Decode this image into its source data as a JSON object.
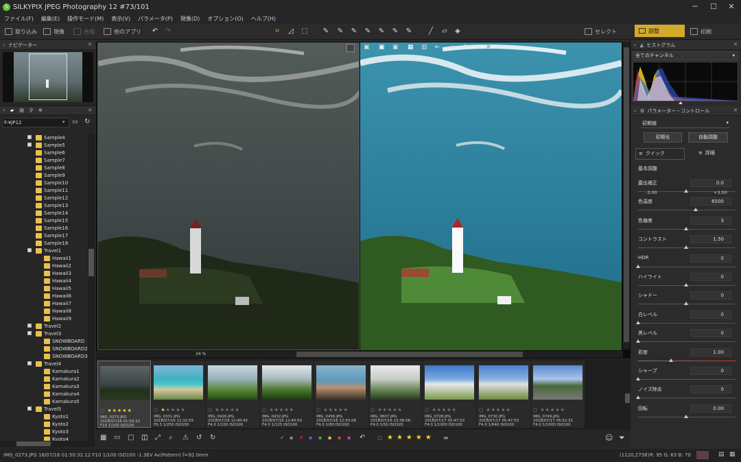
{
  "app": {
    "title": "SILKYPIX JPEG Photography 12   #73/101"
  },
  "menu": [
    "ファイル(F)",
    "編集(E)",
    "操作モード(M)",
    "表示(V)",
    "パラメータ(P)",
    "現像(D)",
    "オプション(O)",
    "ヘルプ(H)"
  ],
  "toolbar": {
    "import": "取り込み",
    "develop": "現像",
    "compose": "合成",
    "other_apps": "他のアプリ",
    "select": "セレクト",
    "adjust": "調整",
    "print": "印刷"
  },
  "navigator": {
    "title": "ナビゲーター"
  },
  "folder": {
    "path": "F:¥JP12"
  },
  "tree": [
    {
      "label": "Sample4",
      "level": 1,
      "exp": "+"
    },
    {
      "label": "Sample5",
      "level": 1,
      "exp": "+"
    },
    {
      "label": "Sample6",
      "level": 1
    },
    {
      "label": "Sample7",
      "level": 1
    },
    {
      "label": "Sample8",
      "level": 1
    },
    {
      "label": "Sample9",
      "level": 1
    },
    {
      "label": "Sample10",
      "level": 1
    },
    {
      "label": "Sample11",
      "level": 1
    },
    {
      "label": "Sample12",
      "level": 1
    },
    {
      "label": "Sample13",
      "level": 1
    },
    {
      "label": "Sample14",
      "level": 1
    },
    {
      "label": "Sample15",
      "level": 1
    },
    {
      "label": "Sample16",
      "level": 1
    },
    {
      "label": "Sample17",
      "level": 1
    },
    {
      "label": "Sample18",
      "level": 1
    },
    {
      "label": "Travel1",
      "level": 1,
      "exp": "-"
    },
    {
      "label": "Hawaii1",
      "level": 2
    },
    {
      "label": "Hawaii2",
      "level": 2
    },
    {
      "label": "Hawaii3",
      "level": 2
    },
    {
      "label": "Hawaii4",
      "level": 2
    },
    {
      "label": "Hawaii5",
      "level": 2
    },
    {
      "label": "Hawaii6",
      "level": 2
    },
    {
      "label": "Hawaii7",
      "level": 2
    },
    {
      "label": "Hawaii8",
      "level": 2
    },
    {
      "label": "Hawaii9",
      "level": 2
    },
    {
      "label": "Travel2",
      "level": 1,
      "exp": "+"
    },
    {
      "label": "Travel3",
      "level": 1,
      "exp": "-"
    },
    {
      "label": "SNOWBOARD",
      "level": 2
    },
    {
      "label": "SNOWBOARD2",
      "level": 2
    },
    {
      "label": "SNOWBOARD3",
      "level": 2
    },
    {
      "label": "Travel4",
      "level": 1,
      "exp": "-"
    },
    {
      "label": "Kamakura1",
      "level": 2
    },
    {
      "label": "Kamakura2",
      "level": 2
    },
    {
      "label": "Kamakura3",
      "level": 2
    },
    {
      "label": "Kamakura4",
      "level": 2
    },
    {
      "label": "Kamakura5",
      "level": 2
    },
    {
      "label": "Travel5",
      "level": 1,
      "exp": "-"
    },
    {
      "label": "Kyoto1",
      "level": 2
    },
    {
      "label": "Kyoto2",
      "level": 2
    },
    {
      "label": "Kyoto3",
      "level": 2
    },
    {
      "label": "Kyoto4",
      "level": 2
    }
  ],
  "viewer": {
    "zoom": "34"
  },
  "filmstrip": [
    {
      "name": "IMG_0273.JPG",
      "date": "2018/07/16 01:50:32",
      "exif": "F10 1/100 ISO100",
      "stars": 5,
      "scene": "light",
      "selected": true
    },
    {
      "name": "IMG_0331.JPG",
      "date": "2018/07/16 11:32:55",
      "exif": "F6.3 1/250 ISO100",
      "stars": 1,
      "scene": "beach"
    },
    {
      "name": "IMG_0426.JPG",
      "date": "2018/07/16 12:40:42",
      "exif": "F4.0 1/100 ISO100",
      "stars": 0,
      "scene": "palm"
    },
    {
      "name": "IMG_0432.JPG",
      "date": "2018/07/16 12:40:50",
      "exif": "F4.0 1/125 ISO100",
      "stars": 0,
      "scene": "palm2"
    },
    {
      "name": "IMG_0456.JPG",
      "date": "2018/07/16 12:50:06",
      "exif": "F4.0 1/80 ISO100",
      "stars": 0,
      "scene": "woman"
    },
    {
      "name": "IMG_0607.JPG",
      "date": "2018/07/16 13:38:58",
      "exif": "F4.0 1/50 ISO320",
      "stars": 0,
      "scene": "sign"
    },
    {
      "name": "IMG_0728.JPG",
      "date": "2018/07/17 05:47:53",
      "exif": "F4.0 1/1000 ISO100",
      "stars": 0,
      "scene": "house"
    },
    {
      "name": "IMG_0730.JPG",
      "date": "2018/07/17 05:47:53",
      "exif": "F4.0 1/640 ISO100",
      "stars": 0,
      "scene": "house2"
    },
    {
      "name": "IMG_0749.JPG",
      "date": "2018/07/17 05:52:31",
      "exif": "F4.0 1/1000 ISO100",
      "stars": 0,
      "scene": "street"
    }
  ],
  "histogram": {
    "title": "ヒストグラム",
    "channel": "全てのチャンネル"
  },
  "params": {
    "title": "パラメーター・コントロール",
    "preset": "初期値",
    "init_btn": "初期化",
    "auto_btn": "自動調整",
    "quick_tab": "クイック",
    "detail_tab": "詳細",
    "section": "基本調整",
    "rows": [
      {
        "label": "露出補正",
        "value": "0.0",
        "min": "-3.00",
        "max": "+3.00",
        "pos": 0.5
      },
      {
        "label": "色温度",
        "value": "6500",
        "pos": 0.6
      },
      {
        "label": "色偏差",
        "value": "3",
        "pos": 0.5
      },
      {
        "label": "コントラスト",
        "value": "1.50",
        "pos": 0.5
      },
      {
        "label": "HDR",
        "value": "0",
        "pos": 0.0
      },
      {
        "label": "ハイライト",
        "value": "0",
        "pos": 0.5
      },
      {
        "label": "シャドー",
        "value": "0",
        "pos": 0.5
      },
      {
        "label": "白レベル",
        "value": "0",
        "pos": 0.0
      },
      {
        "label": "黒レベル",
        "value": "0",
        "pos": 0.0
      },
      {
        "label": "彩度",
        "value": "1.00",
        "pos": 0.34
      },
      {
        "label": "シャープ",
        "value": "0",
        "pos": 0.0
      },
      {
        "label": "ノイズ除去",
        "value": "0",
        "pos": 0.0
      },
      {
        "label": "回転",
        "value": "0.00",
        "pos": 0.5
      }
    ]
  },
  "status": {
    "left": "IMG_0273.JPG 18/07/16 01:50:32.12 F10 1/100 ISO100 -1.3EV Av(Pattern) f=92.0mm",
    "coords": "(1120,2738)",
    "rgb": "R: 95 G: 63 B: 70"
  }
}
